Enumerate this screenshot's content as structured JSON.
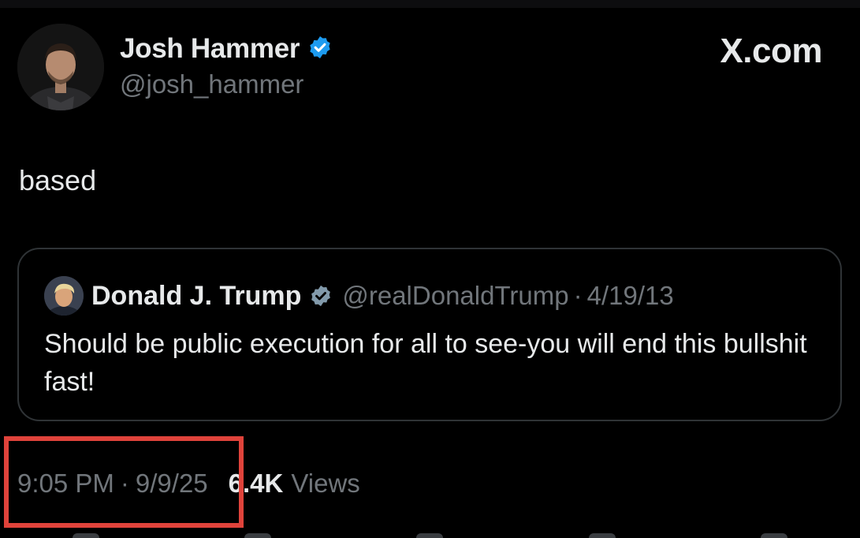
{
  "author": {
    "name": "Josh Hammer",
    "handle": "@josh_hammer",
    "verified_color": "#1d9bf0"
  },
  "brand": {
    "label": "X.com"
  },
  "tweet": {
    "text": "based"
  },
  "quote": {
    "name": "Donald J. Trump",
    "handle": "@realDonaldTrump",
    "separator": "·",
    "date": "4/19/13",
    "text": "Should be public execution for all to see-you will end this bullshit fast!",
    "badge_color": "#829aab"
  },
  "meta": {
    "time": "9:05 PM",
    "separator": "·",
    "date": "9/9/25",
    "views_count": "6.4K",
    "views_label": "Views"
  },
  "highlight": {
    "color": "#e0433b"
  }
}
